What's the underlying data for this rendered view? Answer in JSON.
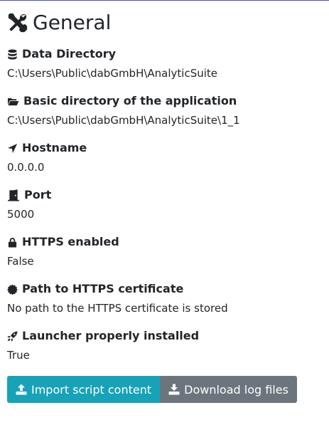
{
  "header": {
    "title": "General",
    "icon": "tools-icon"
  },
  "settings": [
    {
      "label": "Data Directory",
      "value": "C:\\Users\\Public\\dabGmbH\\AnalyticSuite",
      "icon": "database-icon"
    },
    {
      "label": "Basic directory of the application",
      "value": "C:\\Users\\Public\\dabGmbH\\AnalyticSuite\\1_1",
      "icon": "folder-open-icon"
    },
    {
      "label": "Hostname",
      "value": "0.0.0.0",
      "icon": "location-arrow-icon"
    },
    {
      "label": "Port",
      "value": "5000",
      "icon": "door-open-icon"
    },
    {
      "label": "HTTPS enabled",
      "value": "False",
      "icon": "lock-icon"
    },
    {
      "label": "Path to HTTPS certificate",
      "value": "No path to the HTTPS certificate is stored",
      "icon": "certificate-icon"
    },
    {
      "label": "Launcher properly installed",
      "value": "True",
      "icon": "rocket-icon"
    }
  ],
  "actions": {
    "import_label": "Import script content",
    "download_label": "Download log files"
  },
  "colors": {
    "import_button": "#17a2b8",
    "download_button": "#6c757d",
    "text": "#212529"
  }
}
